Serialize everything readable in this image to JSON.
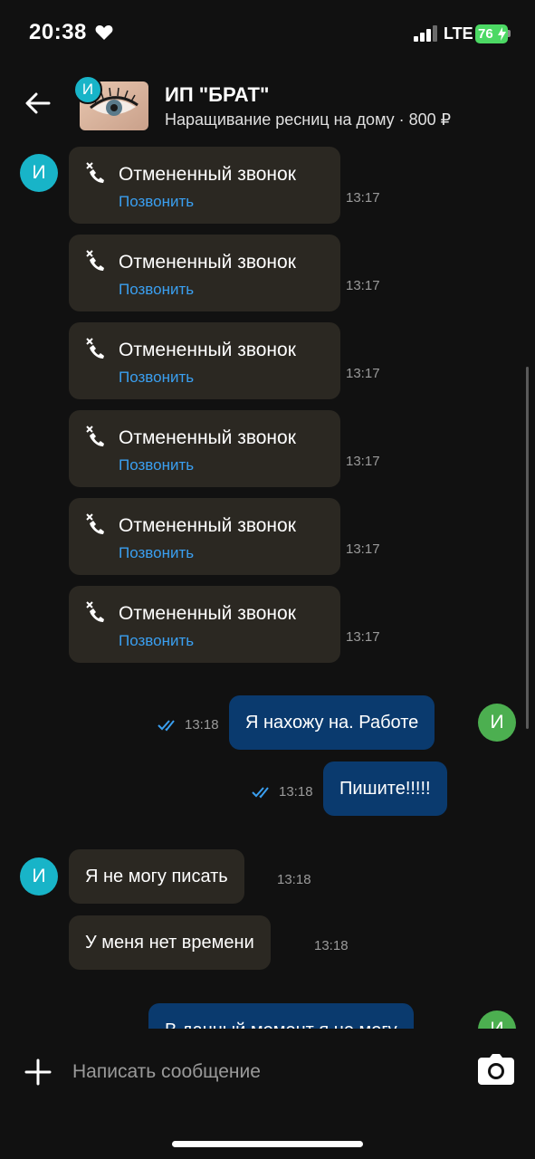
{
  "status_bar": {
    "time": "20:38",
    "network": "LTE",
    "battery": "76"
  },
  "header": {
    "avatar_letter": "И",
    "title": "ИП \"БРАТ\"",
    "subtitle": "Наращивание ресниц на дому · 800 ₽"
  },
  "messages": {
    "calls": [
      {
        "title": "Отмененный звонок",
        "link": "Позвонить",
        "time": "13:17"
      },
      {
        "title": "Отмененный звонок",
        "link": "Позвонить",
        "time": "13:17"
      },
      {
        "title": "Отмененный звонок",
        "link": "Позвонить",
        "time": "13:17"
      },
      {
        "title": "Отмененный звонок",
        "link": "Позвонить",
        "time": "13:17"
      },
      {
        "title": "Отмененный звонок",
        "link": "Позвонить",
        "time": "13:17"
      },
      {
        "title": "Отмененный звонок",
        "link": "Позвонить",
        "time": "13:17"
      }
    ],
    "outgoing": [
      {
        "text": "Я нахожу на. Работе",
        "time": "13:18"
      },
      {
        "text": "Пишите!!!!!",
        "time": "13:18"
      },
      {
        "text": "В данный момент я не могу"
      }
    ],
    "incoming": [
      {
        "text": "Я не могу писать",
        "time": "13:18"
      },
      {
        "text": "У меня  нет времени",
        "time": "13:18"
      }
    ],
    "in_avatar_letter": "И",
    "out_avatar_letter": "И"
  },
  "composer": {
    "placeholder": "Написать сообщение"
  },
  "colors": {
    "incoming_bubble": "#2b2822",
    "outgoing_bubble": "#0a3a6e",
    "link": "#3a9ff0",
    "in_avatar": "#18b4c8",
    "out_avatar": "#4caf50",
    "battery": "#4cd964"
  },
  "icons": [
    "heart-icon",
    "signal-icon",
    "back-arrow-icon",
    "missed-call-icon",
    "double-check-icon",
    "plus-icon",
    "camera-icon"
  ]
}
